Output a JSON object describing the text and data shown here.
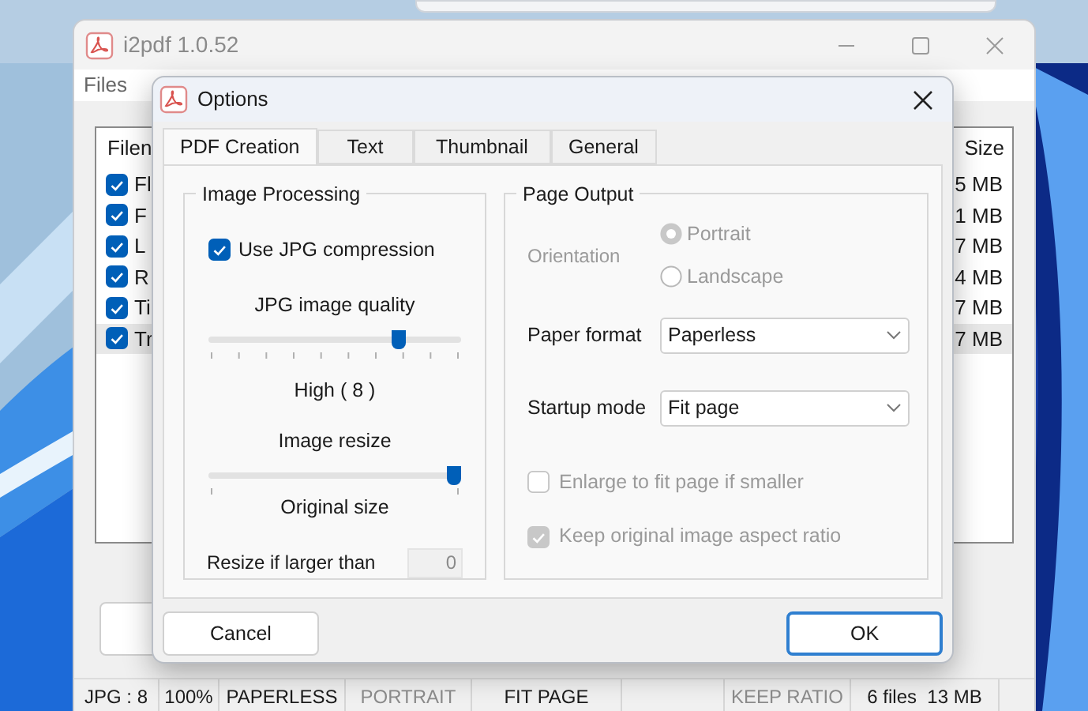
{
  "main_window": {
    "title": "i2pdf 1.0.52",
    "menu": [
      "Files"
    ],
    "file_list": {
      "columns": [
        "Filen",
        "Size"
      ],
      "rows": [
        {
          "name": "Fl",
          "size": "5 MB",
          "checked": true,
          "selected": false
        },
        {
          "name": "F",
          "size": "1 MB",
          "checked": true,
          "selected": false
        },
        {
          "name": "L",
          "size": "7 MB",
          "checked": true,
          "selected": false
        },
        {
          "name": "R",
          "size": "4 MB",
          "checked": true,
          "selected": false
        },
        {
          "name": "Ti",
          "size": "7 MB",
          "checked": true,
          "selected": false
        },
        {
          "name": "Tr",
          "size": "7 MB",
          "checked": true,
          "selected": true
        }
      ]
    },
    "status_bar": [
      {
        "kind": "text",
        "text": "JPG : 8",
        "disabled": false
      },
      {
        "kind": "text",
        "text": "100%",
        "disabled": false
      },
      {
        "kind": "text",
        "text": "PAPERLESS",
        "disabled": false
      },
      {
        "kind": "text",
        "text": "PORTRAIT",
        "disabled": true
      },
      {
        "kind": "text",
        "text": "FIT PAGE",
        "disabled": false
      },
      {
        "kind": "blank"
      },
      {
        "kind": "text",
        "text": "KEEP RATIO",
        "disabled": true
      },
      {
        "kind": "text",
        "text": "6 files  13 MB",
        "disabled": false
      }
    ]
  },
  "dialog": {
    "title": "Options",
    "tabs": [
      {
        "label": "PDF Creation",
        "selected": true
      },
      {
        "label": "Text",
        "selected": false
      },
      {
        "label": "Thumbnail",
        "selected": false
      },
      {
        "label": "General",
        "selected": false
      }
    ],
    "image_processing": {
      "title": "Image Processing",
      "jpg_compression": {
        "label": "Use JPG compression",
        "checked": true
      },
      "quality": {
        "label": "JPG image quality",
        "level": 0.77,
        "reading": "High ( 8 )"
      },
      "resize": {
        "label": "Image resize",
        "level": 1,
        "reading": "Original size"
      },
      "resize_limit": {
        "label": "Resize if larger than",
        "value": "0",
        "disabled": true
      }
    },
    "page_output": {
      "title": "Page Output",
      "orientation": {
        "label": "Orientation",
        "disabled": true,
        "options": [
          {
            "label": "Portrait",
            "selected": true
          },
          {
            "label": "Landscape",
            "selected": false
          }
        ]
      },
      "paper_format": {
        "label": "Paper format",
        "value": "Paperless"
      },
      "startup_mode": {
        "label": "Startup mode",
        "value": "Fit page"
      },
      "options": [
        {
          "label": "Enlarge to fit page if smaller",
          "checked": false,
          "disabled": true
        },
        {
          "label": "Keep original image aspect ratio",
          "checked": true,
          "disabled": true
        }
      ]
    },
    "buttons": [
      {
        "label": "Cancel",
        "default": false
      },
      {
        "label": "OK",
        "default": true
      }
    ]
  }
}
